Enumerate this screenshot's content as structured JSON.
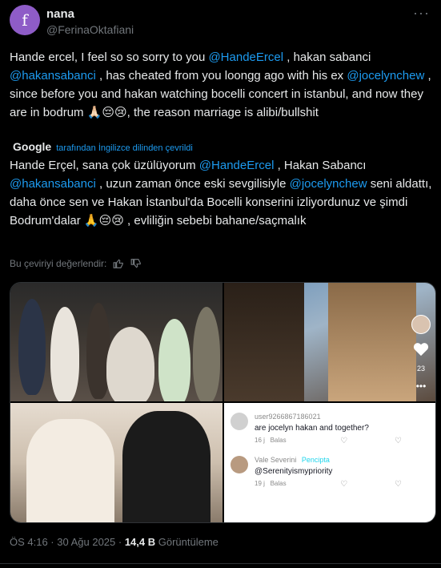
{
  "author": {
    "avatar_letter": "f",
    "name": "nana",
    "handle": "@FerinaOktafiani"
  },
  "tweet": {
    "en_parts": [
      "Hande ercel, I feel so so sorry to you ",
      "@HandeErcel",
      " , hakan sabanci ",
      "@hakansabanci",
      " , has cheated from you loongg ago with his ex ",
      "@jocelynchew",
      " , since before you and hakan watching bocelli concert in istanbul, and now they are in bodrum 🙏🏻😔😢, the reason marriage is alibi/bullshit"
    ],
    "translation_provider": "Google",
    "translation_note": "tarafından İngilizce dilinden çevrildi",
    "tr_parts": [
      "Hande Erçel, sana çok üzülüyorum ",
      "@HandeErcel",
      " , Hakan Sabancı ",
      "@hakansabanci",
      " , uzun zaman önce eski sevgilisiyle ",
      "@jocelynchew",
      " seni aldattı, daha önce sen ve Hakan İstanbul'da Bocelli konserini izliyordunuz ve şimdi Bodrum'dalar 🙏😔😢 , evliliğin sebebi bahane/saçmalık"
    ],
    "rate_label": "Bu çeviriyi değerlendir:"
  },
  "media": {
    "tiktok": {
      "likes": "23"
    },
    "comments": [
      {
        "user": "user9266867186021",
        "text": "are jocelyn hakan and together?",
        "time": "16 j",
        "reply": "Balas"
      },
      {
        "user": "Vale Severini",
        "badge": "Pencipta",
        "text": "@Serenityismypriority",
        "time": "19 j",
        "reply": "Balas"
      }
    ]
  },
  "footer": {
    "time": "ÖS 4:16 · 30 Ağu 2025 · ",
    "views": "14,4 B",
    "views_label": " Görüntüleme"
  },
  "colors": {
    "accent": "#1d9bf0",
    "background": "#000000",
    "text": "#e7e9ea",
    "muted": "#71767b"
  }
}
